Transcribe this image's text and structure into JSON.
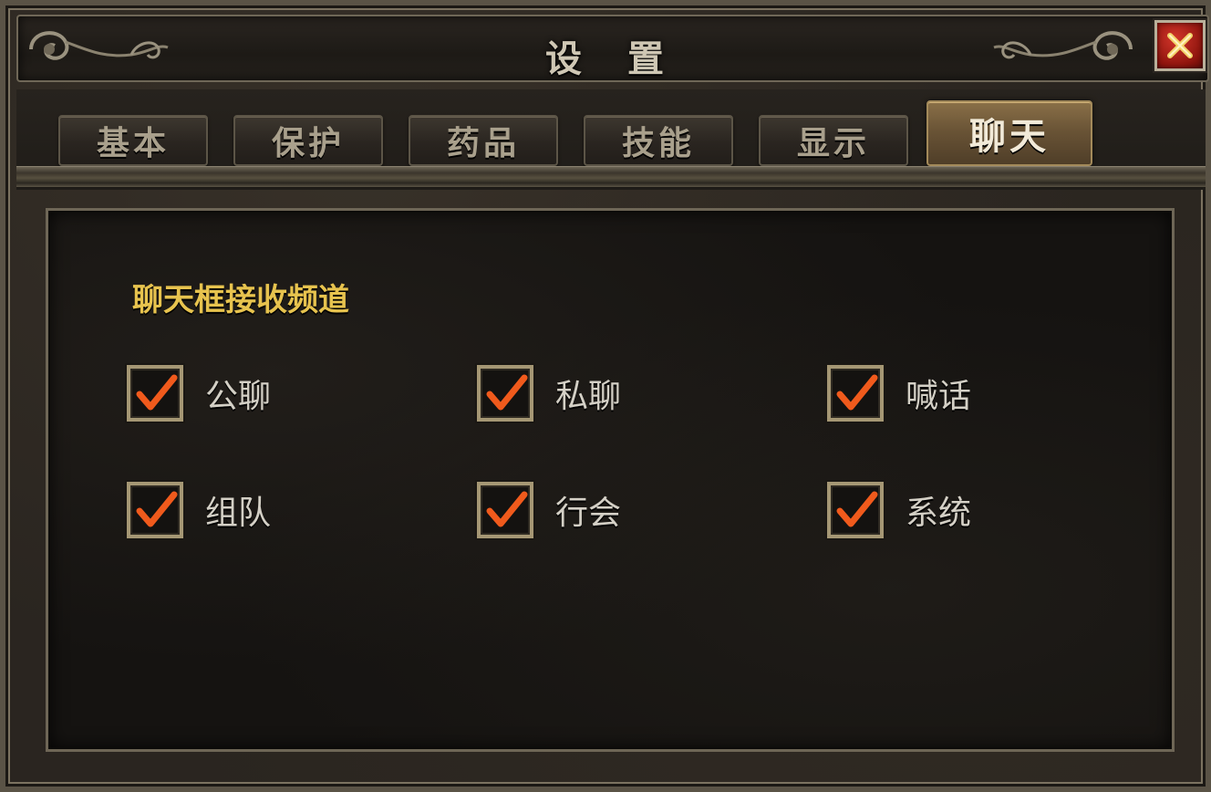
{
  "window": {
    "title": "设 置",
    "close_label": "close"
  },
  "tabs": [
    {
      "label": "基本",
      "active": false
    },
    {
      "label": "保护",
      "active": false
    },
    {
      "label": "药品",
      "active": false
    },
    {
      "label": "技能",
      "active": false
    },
    {
      "label": "显示",
      "active": false
    },
    {
      "label": "聊天",
      "active": true
    }
  ],
  "chat": {
    "section_title": "聊天框接收频道",
    "options": [
      {
        "label": "公聊",
        "checked": true
      },
      {
        "label": "私聊",
        "checked": true
      },
      {
        "label": "喊话",
        "checked": true
      },
      {
        "label": "组队",
        "checked": true
      },
      {
        "label": "行会",
        "checked": true
      },
      {
        "label": "系统",
        "checked": true
      }
    ]
  },
  "colors": {
    "section_title": "#e7c34e",
    "checkmark": "#f05a1c",
    "close_button": "#b81f16",
    "active_tab": "#7a6240"
  },
  "icons": {
    "close": "close-x-icon",
    "check": "check-icon",
    "ornament": "scroll-ornament-icon"
  }
}
